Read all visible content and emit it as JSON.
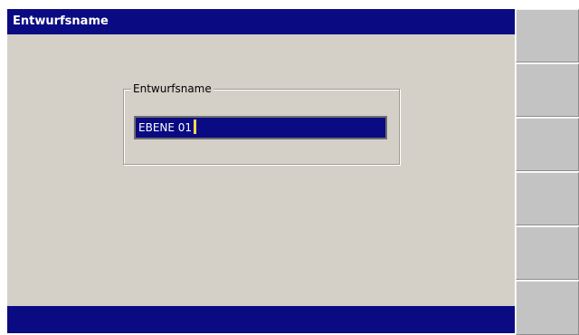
{
  "window": {
    "title": "Entwurfsname"
  },
  "form": {
    "group_label": "Entwurfsname",
    "name_value": "EBENE 01"
  },
  "softkeys": [
    "",
    "",
    "",
    "",
    "",
    ""
  ]
}
